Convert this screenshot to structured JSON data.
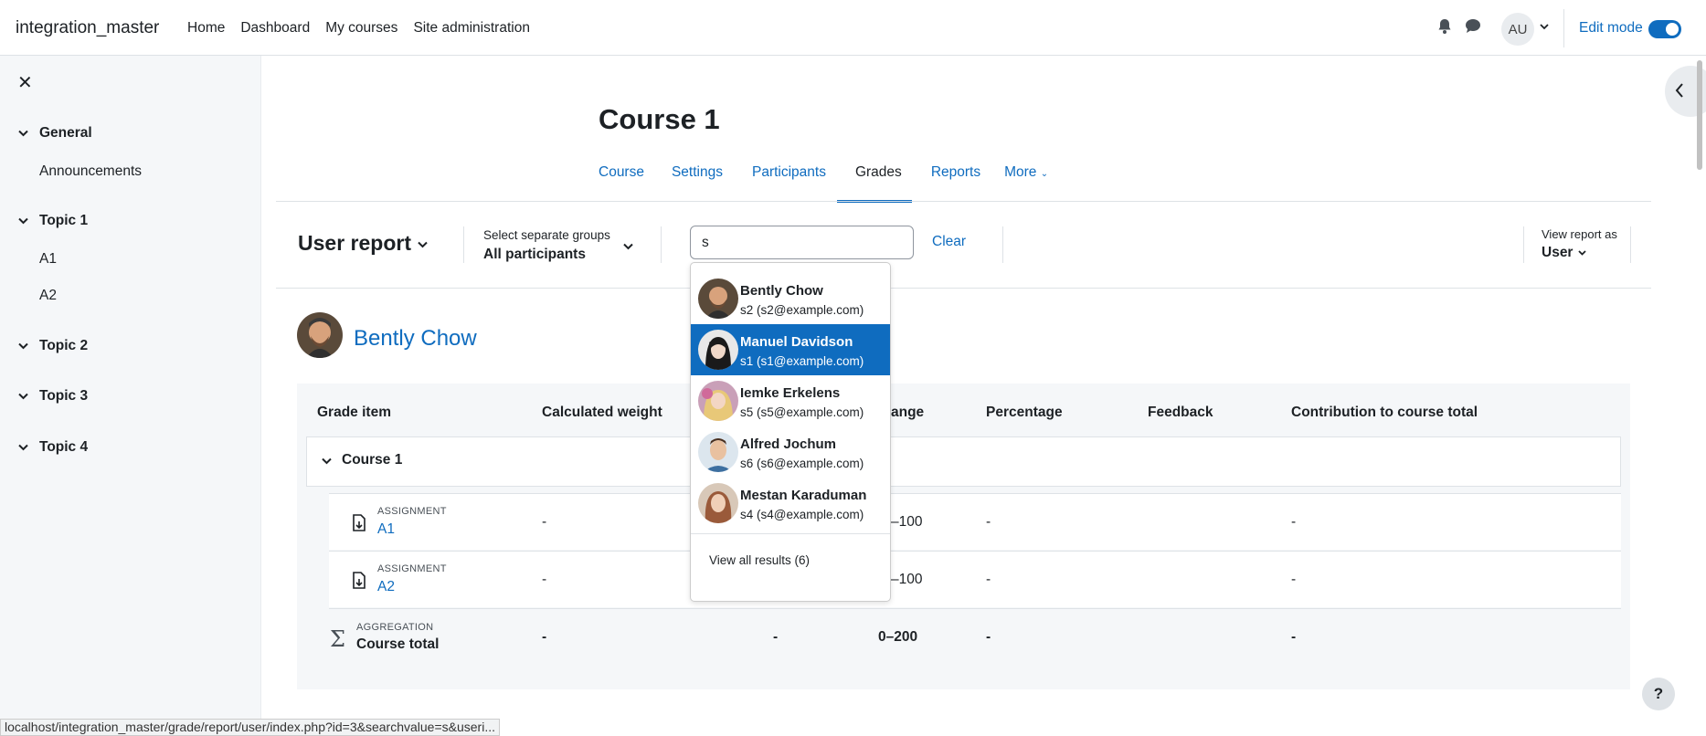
{
  "site": {
    "brand": "integration_master"
  },
  "topnav": {
    "items": [
      "Home",
      "Dashboard",
      "My courses",
      "Site administration"
    ]
  },
  "user_menu": {
    "initials": "AU"
  },
  "edit_mode": {
    "label": "Edit mode",
    "on": true
  },
  "drawer": {
    "sections": [
      {
        "label": "General",
        "items": [
          "Announcements"
        ]
      },
      {
        "label": "Topic 1",
        "items": [
          "A1",
          "A2"
        ]
      },
      {
        "label": "Topic 2",
        "items": []
      },
      {
        "label": "Topic 3",
        "items": []
      },
      {
        "label": "Topic 4",
        "items": []
      }
    ]
  },
  "course": {
    "title": "Course 1",
    "tabs": [
      "Course",
      "Settings",
      "Participants",
      "Grades",
      "Reports",
      "More"
    ],
    "active_tab": "Grades"
  },
  "report": {
    "title": "User report",
    "group_label": "Select separate groups",
    "group_value": "All participants",
    "search_value": "s",
    "clear_label": "Clear",
    "view_as_label": "View report as",
    "view_as_value": "User"
  },
  "selected_user": {
    "name": "Bently Chow"
  },
  "dropdown": {
    "results": [
      {
        "name": "Bently Chow",
        "email": "s2 (s2@example.com)",
        "active": false
      },
      {
        "name": "Manuel Davidson",
        "email": "s1 (s1@example.com)",
        "active": true
      },
      {
        "name": "Iemke Erkelens",
        "email": "s5 (s5@example.com)",
        "active": false
      },
      {
        "name": "Alfred Jochum",
        "email": "s6 (s6@example.com)",
        "active": false
      },
      {
        "name": "Mestan Karaduman",
        "email": "s4 (s4@example.com)",
        "active": false
      }
    ],
    "view_all": "View all results (6)"
  },
  "table": {
    "headers": [
      "Grade item",
      "Calculated weight",
      "ange",
      "Percentage",
      "Feedback",
      "Contribution to course total"
    ],
    "category": "Course 1",
    "rows": [
      {
        "type": "ASSIGNMENT",
        "name": "A1",
        "weight": "-",
        "range": "–100",
        "percentage": "-",
        "contribution": "-"
      },
      {
        "type": "ASSIGNMENT",
        "name": "A2",
        "weight": "-",
        "range": "–100",
        "percentage": "-",
        "contribution": "-"
      }
    ],
    "total": {
      "type": "AGGREGATION",
      "name": "Course total",
      "weight": "-",
      "grade": "-",
      "range": "0–200",
      "percentage": "-",
      "contribution": "-"
    }
  },
  "statusbar": {
    "url": "localhost/integration_master/grade/report/user/index.php?id=3&searchvalue=s&useri..."
  },
  "help": {
    "label": "?"
  },
  "colors": {
    "primary": "#0f6cbf",
    "drawer_bg": "#f5f7f9",
    "text": "#1d2125"
  }
}
